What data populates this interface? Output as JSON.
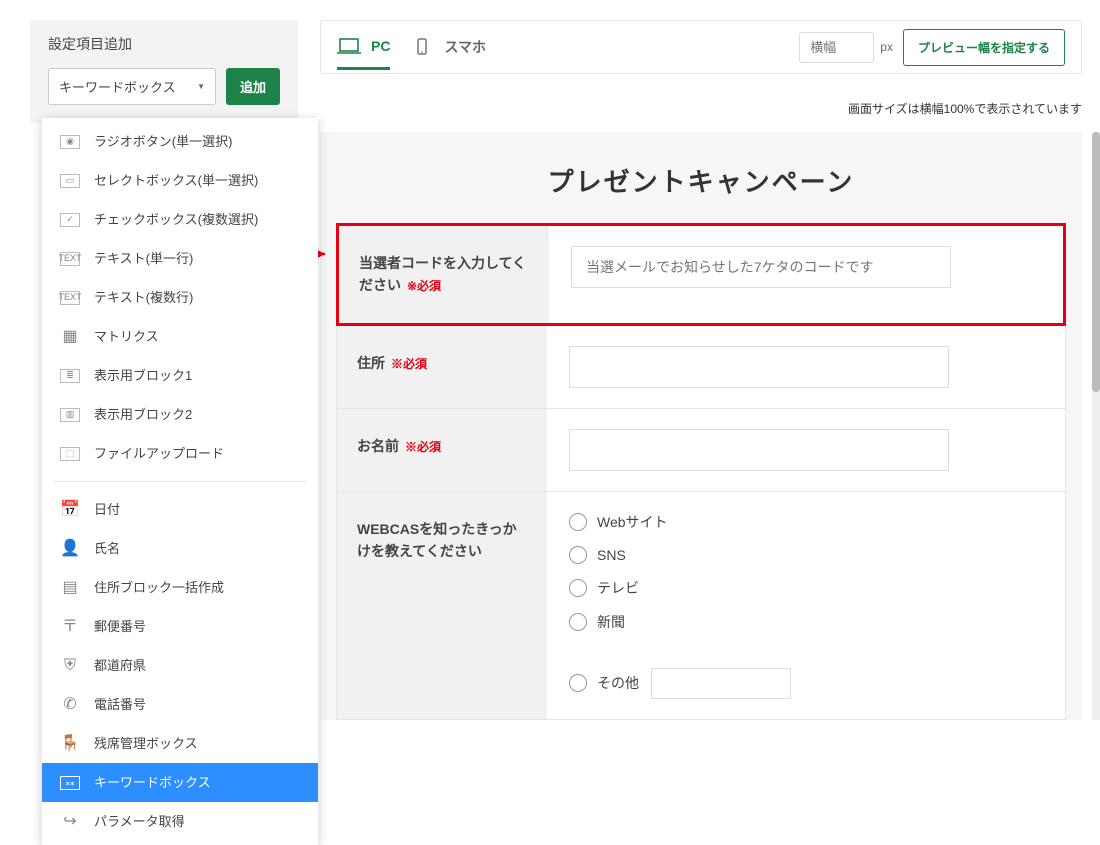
{
  "sidebar": {
    "title": "設定項目追加",
    "select_value": "キーワードボックス",
    "add_label": "追加"
  },
  "dropdown": {
    "groups": [
      [
        {
          "key": "radio",
          "label": "ラジオボタン(単一選択)",
          "ico": "◉"
        },
        {
          "key": "select",
          "label": "セレクトボックス(単一選択)",
          "ico": "▭"
        },
        {
          "key": "checkbox",
          "label": "チェックボックス(複数選択)",
          "ico": "✓"
        },
        {
          "key": "text1",
          "label": "テキスト(単一行)",
          "ico": "TEXT"
        },
        {
          "key": "textn",
          "label": "テキスト(複数行)",
          "ico": "TEXT"
        },
        {
          "key": "matrix",
          "label": "マトリクス",
          "ico": "▦"
        },
        {
          "key": "block1",
          "label": "表示用ブロック1",
          "ico": "≣"
        },
        {
          "key": "block2",
          "label": "表示用ブロック2",
          "ico": "▥"
        },
        {
          "key": "file",
          "label": "ファイルアップロード",
          "ico": "⬚"
        }
      ],
      [
        {
          "key": "date",
          "label": "日付",
          "ico": "📅"
        },
        {
          "key": "name",
          "label": "氏名",
          "ico": "👤"
        },
        {
          "key": "addrblock",
          "label": "住所ブロック一括作成",
          "ico": "▤"
        },
        {
          "key": "zip",
          "label": "郵便番号",
          "ico": "〒"
        },
        {
          "key": "pref",
          "label": "都道府県",
          "ico": "⛨"
        },
        {
          "key": "tel",
          "label": "電話番号",
          "ico": "✆"
        },
        {
          "key": "seat",
          "label": "残席管理ボックス",
          "ico": "🪑"
        },
        {
          "key": "keyword",
          "label": "キーワードボックス",
          "ico": "⁎⁎",
          "selected": true
        },
        {
          "key": "param",
          "label": "パラメータ取得",
          "ico": "↪"
        }
      ]
    ]
  },
  "header": {
    "pc_label": "PC",
    "sp_label": "スマホ",
    "width_placeholder": "横幅",
    "px_label": "px",
    "preview_btn": "プレビュー幅を指定する",
    "note": "画面サイズは横幅100%で表示されています"
  },
  "form": {
    "title": "プレゼントキャンペーン",
    "required_label": "※必須",
    "rows": [
      {
        "key": "code",
        "label": "当選者コードを入力してください",
        "required": true,
        "placeholder": "当選メールでお知らせした7ケタのコードです",
        "highlight": true,
        "type": "text"
      },
      {
        "key": "address",
        "label": "住所",
        "required": true,
        "type": "text"
      },
      {
        "key": "name",
        "label": "お名前",
        "required": true,
        "type": "text"
      },
      {
        "key": "source",
        "label": "WEBCASを知ったきっかけを教えてください",
        "required": false,
        "type": "radio",
        "options": [
          "Webサイト",
          "SNS",
          "テレビ",
          "新聞",
          "_sep",
          "その他"
        ]
      }
    ]
  }
}
